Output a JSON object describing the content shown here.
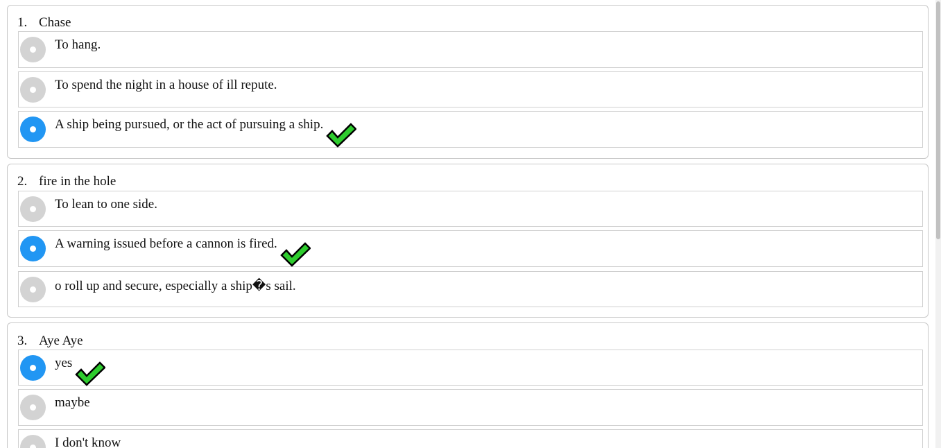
{
  "questions": [
    {
      "number": "1.",
      "title": "Chase",
      "options": [
        {
          "text": "To hang.",
          "selected": false,
          "correct": false
        },
        {
          "text": "To spend the night in a house of ill repute.",
          "selected": false,
          "correct": false
        },
        {
          "text": "A ship being pursued, or the act of pursuing a ship.",
          "selected": true,
          "correct": true
        }
      ]
    },
    {
      "number": "2.",
      "title": "fire in the hole",
      "options": [
        {
          "text": "To lean to one side.",
          "selected": false,
          "correct": false
        },
        {
          "text": "A warning issued before a cannon is fired.",
          "selected": true,
          "correct": true
        },
        {
          "text": "o roll up and secure, especially a ship�s sail.",
          "selected": false,
          "correct": false
        }
      ]
    },
    {
      "number": "3.",
      "title": "Aye Aye",
      "options": [
        {
          "text": "yes",
          "selected": true,
          "correct": true
        },
        {
          "text": "maybe",
          "selected": false,
          "correct": false
        },
        {
          "text": "I don't know",
          "selected": false,
          "correct": false
        }
      ]
    }
  ],
  "colors": {
    "selected_radio": "#2196f3",
    "unselected_radio": "#d3d3d3",
    "check_fill": "#2ecc2e"
  },
  "icons": {
    "radio": "radio-icon",
    "correct": "checkmark-icon"
  }
}
